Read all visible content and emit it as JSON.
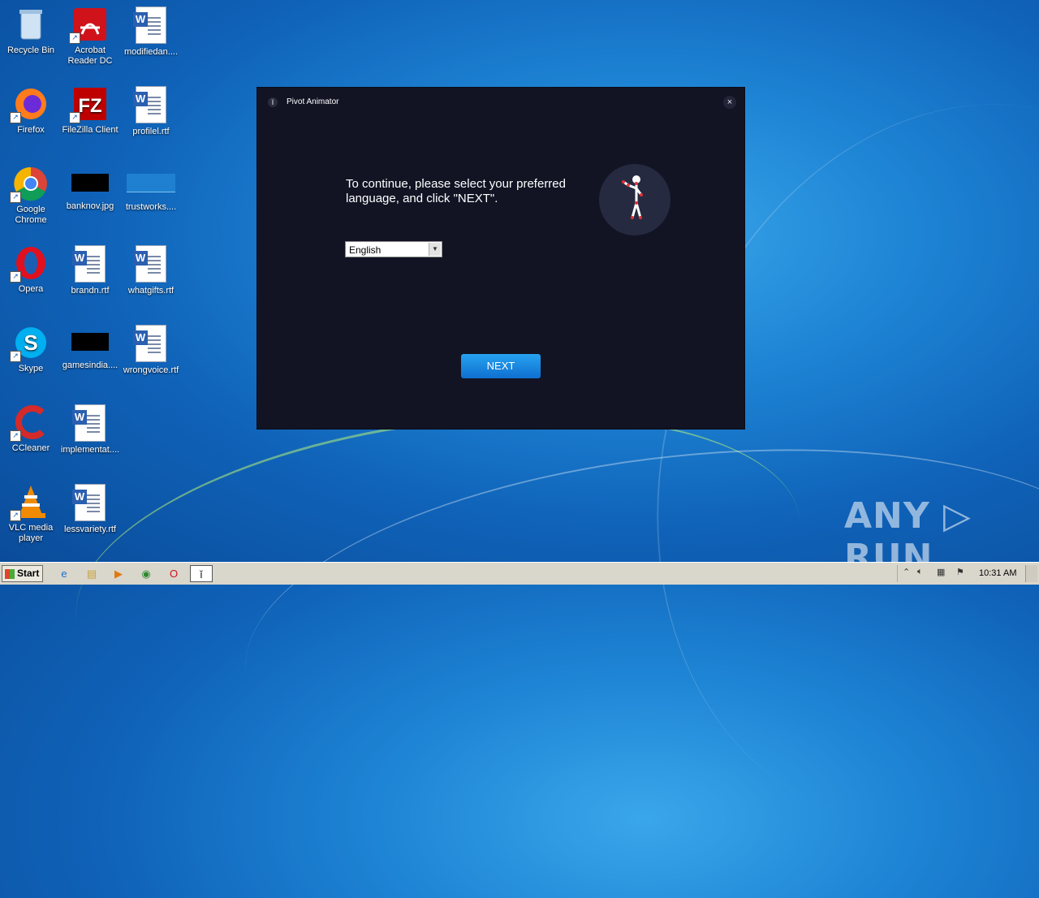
{
  "desktop": {
    "icons": [
      {
        "label": "Recycle Bin"
      },
      {
        "label": "Acrobat Reader DC"
      },
      {
        "label": "modifiedan...."
      },
      {
        "label": "Firefox"
      },
      {
        "label": "FileZilla Client"
      },
      {
        "label": "profilel.rtf"
      },
      {
        "label": "Google Chrome"
      },
      {
        "label": "banknov.jpg"
      },
      {
        "label": "trustworks...."
      },
      {
        "label": "Opera"
      },
      {
        "label": "brandn.rtf"
      },
      {
        "label": "whatgifts.rtf"
      },
      {
        "label": "Skype"
      },
      {
        "label": "gamesindia...."
      },
      {
        "label": "wrongvoice.rtf"
      },
      {
        "label": "CCleaner"
      },
      {
        "label": "implementat...."
      },
      {
        "label": "VLC media player"
      },
      {
        "label": "lessvariety.rtf"
      }
    ],
    "watermark": "ANY ▷ RUN"
  },
  "window": {
    "title": "Pivot Animator",
    "close_glyph": "×",
    "prompt": "To continue, please select your preferred language, and click \"NEXT\".",
    "language": {
      "selected": "English",
      "dropdown_glyph": "▼"
    },
    "next_label": "NEXT",
    "accent": "#1a8fe6"
  },
  "taskbar": {
    "start_label": "Start",
    "clock": "10:31 AM"
  }
}
